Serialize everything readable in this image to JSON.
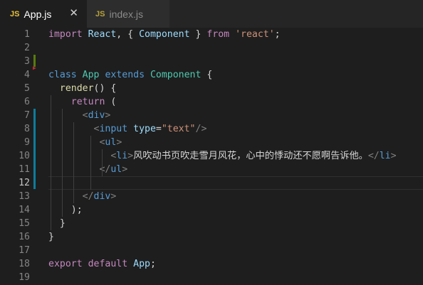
{
  "tabs": [
    {
      "icon": "JS",
      "label": "App.js",
      "active": true,
      "close": "✕"
    },
    {
      "icon": "JS",
      "label": "index.js",
      "active": false
    }
  ],
  "editor": {
    "current_line": 12,
    "lines": [
      {
        "n": "1",
        "tokens": [
          [
            "kw",
            "import"
          ],
          [
            "tx",
            " "
          ],
          [
            "vr",
            "React"
          ],
          [
            "tx",
            ", { "
          ],
          [
            "vr",
            "Component"
          ],
          [
            "tx",
            " } "
          ],
          [
            "kw",
            "from"
          ],
          [
            "tx",
            " "
          ],
          [
            "st",
            "'react'"
          ],
          [
            "tx",
            ";"
          ]
        ]
      },
      {
        "n": "2",
        "tokens": []
      },
      {
        "n": "3",
        "tokens": []
      },
      {
        "n": "4",
        "tokens": [
          [
            "kb",
            "class"
          ],
          [
            "tx",
            " "
          ],
          [
            "cl",
            "App"
          ],
          [
            "tx",
            " "
          ],
          [
            "kb",
            "extends"
          ],
          [
            "tx",
            " "
          ],
          [
            "cl",
            "Component"
          ],
          [
            "tx",
            " {"
          ]
        ]
      },
      {
        "n": "5",
        "tokens": [
          [
            "tx",
            "  "
          ],
          [
            "fn",
            "render"
          ],
          [
            "tx",
            "() {"
          ]
        ]
      },
      {
        "n": "6",
        "tokens": [
          [
            "tx",
            "    "
          ],
          [
            "kw",
            "return"
          ],
          [
            "tx",
            " ("
          ]
        ]
      },
      {
        "n": "7",
        "tokens": [
          [
            "tx",
            "      "
          ],
          [
            "br",
            "<"
          ],
          [
            "tg",
            "div"
          ],
          [
            "br",
            ">"
          ]
        ]
      },
      {
        "n": "8",
        "tokens": [
          [
            "tx",
            "        "
          ],
          [
            "br",
            "<"
          ],
          [
            "tg",
            "input"
          ],
          [
            "tx",
            " "
          ],
          [
            "at",
            "type"
          ],
          [
            "tx",
            "="
          ],
          [
            "st",
            "\"text\""
          ],
          [
            "br",
            "/>"
          ]
        ]
      },
      {
        "n": "9",
        "tokens": [
          [
            "tx",
            "         "
          ],
          [
            "br",
            "<"
          ],
          [
            "tg",
            "ul"
          ],
          [
            "br",
            ">"
          ]
        ]
      },
      {
        "n": "10",
        "tokens": [
          [
            "tx",
            "           "
          ],
          [
            "br",
            "<"
          ],
          [
            "tg",
            "li"
          ],
          [
            "br",
            ">"
          ],
          [
            "tx",
            "风吹动书页吹走雪月风花，心中的悸动还不愿啊告诉他。"
          ],
          [
            "br",
            "</"
          ],
          [
            "tg",
            "li"
          ],
          [
            "br",
            ">"
          ]
        ]
      },
      {
        "n": "11",
        "tokens": [
          [
            "tx",
            "         "
          ],
          [
            "br",
            "</"
          ],
          [
            "tg",
            "ul"
          ],
          [
            "br",
            ">"
          ]
        ]
      },
      {
        "n": "12",
        "tokens": []
      },
      {
        "n": "13",
        "tokens": [
          [
            "tx",
            "      "
          ],
          [
            "br",
            "</"
          ],
          [
            "tg",
            "div"
          ],
          [
            "br",
            ">"
          ]
        ]
      },
      {
        "n": "14",
        "tokens": [
          [
            "tx",
            "    );"
          ]
        ]
      },
      {
        "n": "15",
        "tokens": [
          [
            "tx",
            "  }"
          ]
        ]
      },
      {
        "n": "16",
        "tokens": [
          [
            "tx",
            "}"
          ]
        ]
      },
      {
        "n": "17",
        "tokens": []
      },
      {
        "n": "18",
        "tokens": [
          [
            "kw",
            "export"
          ],
          [
            "tx",
            " "
          ],
          [
            "kw",
            "default"
          ],
          [
            "tx",
            " "
          ],
          [
            "vr",
            "App"
          ],
          [
            "tx",
            ";"
          ]
        ]
      },
      {
        "n": "19",
        "tokens": []
      }
    ]
  },
  "colors": {
    "added": "#587c0c",
    "modified": "#0c7d9d",
    "background": "#1e1e1e",
    "fold_arrow": "#c5293a"
  }
}
